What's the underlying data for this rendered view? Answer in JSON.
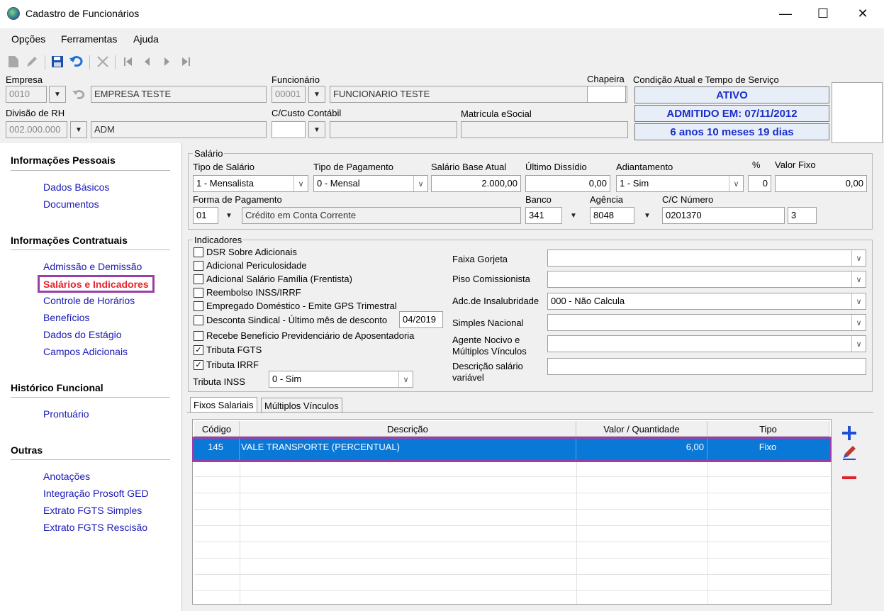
{
  "window": {
    "title": "Cadastro de Funcionários",
    "minimize": "—",
    "maximize": "☐",
    "close": "✕"
  },
  "menu": [
    {
      "label": "Opções"
    },
    {
      "label": "Ferramentas"
    },
    {
      "label": "Ajuda"
    }
  ],
  "toolbar_icons": [
    "new-document-icon",
    "edit-pencil-icon",
    "save-icon",
    "undo-icon",
    "delete-x-icon",
    "first-record-icon",
    "previous-record-icon",
    "next-record-icon",
    "last-record-icon"
  ],
  "header": {
    "empresa_label": "Empresa",
    "empresa_code": "0010",
    "empresa_name": "EMPRESA TESTE",
    "divisao_label": "Divisão de RH",
    "divisao_code": "002.000.000",
    "divisao_name": "ADM",
    "funcionario_label": "Funcionário",
    "funcionario_code": "00001",
    "funcionario_name": "FUNCIONARIO TESTE",
    "ccusto_label": "C/Custo Contábil",
    "ccusto_code": "",
    "ccusto_name": "",
    "matricula_label": "Matrícula eSocial",
    "matricula_value": "",
    "chapeira_label": "Chapeira",
    "chapeira_value": "",
    "condicao_label": "Condição Atual e Tempo de Serviço",
    "status": "ATIVO",
    "admitido": "ADMITIDO EM: 07/11/2012",
    "tempo": "6 anos 10 meses 19 dias"
  },
  "nav": {
    "sections": [
      {
        "title": "Informações Pessoais",
        "items": [
          "Dados Básicos",
          "Documentos"
        ]
      },
      {
        "title": "Informações Contratuais",
        "items": [
          "Admissão e Demissão",
          "Salários e Indicadores",
          "Controle de Horários",
          "Benefícios",
          "Dados do Estágio",
          "Campos Adicionais"
        ]
      },
      {
        "title": "Histórico Funcional",
        "items": [
          "Prontuário"
        ]
      },
      {
        "title": "Outras",
        "items": [
          "Anotações",
          "Integração Prosoft GED",
          "Extrato FGTS Simples",
          "Extrato FGTS Rescisão"
        ]
      }
    ],
    "active": "Salários e Indicadores"
  },
  "salario": {
    "group_title": "Salário",
    "tipo_salario_label": "Tipo de Salário",
    "tipo_salario_value": "1 - Mensalista",
    "tipo_pagamento_label": "Tipo de Pagamento",
    "tipo_pagamento_value": "0 - Mensal",
    "salario_base_label": "Salário Base Atual",
    "salario_base_value": "2.000,00",
    "ultimo_dissidio_label": "Último Dissídio",
    "ultimo_dissidio_value": "0,00",
    "adiantamento_label": "Adiantamento",
    "adiantamento_value": "1 - Sim",
    "pct_label": "%",
    "pct_value": "0",
    "valor_fixo_label": "Valor Fixo",
    "valor_fixo_value": "0,00",
    "forma_pagamento_label": "Forma de Pagamento",
    "forma_pagamento_code": "01",
    "forma_pagamento_value": "Crédito em Conta Corrente",
    "banco_label": "Banco",
    "banco_value": "341",
    "agencia_label": "Agência",
    "agencia_value": "8048",
    "cc_label": "C/C Número",
    "cc_value": "0201370",
    "cc_digit": "3"
  },
  "indicadores": {
    "group_title": "Indicadores",
    "checkboxes": [
      {
        "label": "DSR Sobre Adicionais",
        "checked": ""
      },
      {
        "label": "Adicional Periculosidade",
        "checked": ""
      },
      {
        "label": "Adicional Salário Família (Frentista)",
        "checked": ""
      },
      {
        "label": "Reembolso INSS/IRRF",
        "checked": ""
      },
      {
        "label": "Empregado Doméstico - Emite GPS Trimestral",
        "checked": ""
      },
      {
        "label": "Desconta Sindical - Último mês de desconto",
        "checked": ""
      },
      {
        "label": "Recebe Benefício Previdenciário de Aposentadoria",
        "checked": ""
      },
      {
        "label": "Tributa FGTS",
        "checked": "✓"
      },
      {
        "label": "Tributa IRRF",
        "checked": "✓"
      }
    ],
    "sindical_mes": "04/2019",
    "tributa_inss_label": "Tributa INSS",
    "tributa_inss_value": "0 - Sim",
    "faixa_gorjeta_label": "Faixa Gorjeta",
    "faixa_gorjeta_value": "",
    "piso_label": "Piso Comissionista",
    "piso_value": "",
    "insalubridade_label": "Adc.de Insalubridade",
    "insalubridade_value": "000 - Não Calcula",
    "simples_label": "Simples Nacional",
    "simples_value": "",
    "agente_label_1": "Agente Nocivo e",
    "agente_label_2": "Múltiplos Vínculos",
    "agente_value": "",
    "descricao_label_1": "Descrição salário",
    "descricao_label_2": "variável",
    "descricao_value": ""
  },
  "tabs": [
    {
      "label": "Fixos Salariais"
    },
    {
      "label": "Múltiplos Vínculos"
    }
  ],
  "grid": {
    "columns": [
      "Código",
      "Descrição",
      "Valor / Quantidade",
      "Tipo"
    ],
    "rows": [
      {
        "codigo": "145",
        "descricao": "VALE TRANSPORTE (PERCENTUAL)",
        "valor": "6,00",
        "tipo": "Fixo"
      }
    ]
  },
  "colors": {
    "accent": "#0a78d6",
    "highlight": "#9b3fa8",
    "link": "#1a1ab8",
    "active_link": "#e8232b",
    "status_text": "#1a2ec8"
  }
}
